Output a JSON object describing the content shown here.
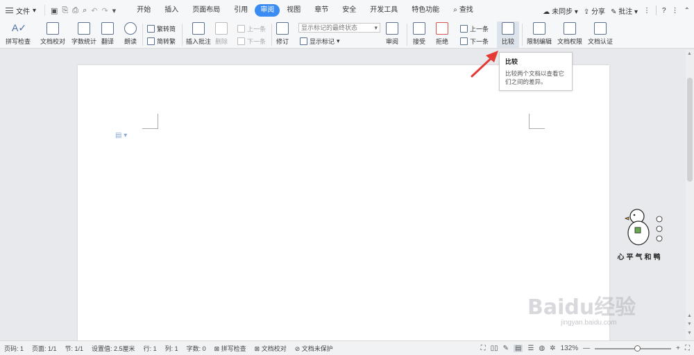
{
  "app": {
    "file_menu": "文件",
    "tabs": [
      "开始",
      "插入",
      "页面布局",
      "引用",
      "审阅",
      "视图",
      "章节",
      "安全",
      "开发工具",
      "特色功能"
    ],
    "active_tab": "审阅",
    "search_label": "查找",
    "sync_label": "未同步",
    "share_label": "分享",
    "comment_label": "批注",
    "help_label": "?"
  },
  "ribbon": {
    "spell_check": "拼写检查",
    "doc_proofread": "文档校对",
    "word_count": "字数统计",
    "translate": "翻译",
    "read_aloud": "朗读",
    "trad_to_simp": "繁转简",
    "simp_to_trad": "简转繁",
    "insert_comment": "插入批注",
    "delete": "删除",
    "prev_item": "上一条",
    "next_item": "下一条",
    "revise": "修订",
    "markup_state": "显示标记的最终状态",
    "show_markup": "显示标记",
    "review_pane": "审阅",
    "accept": "接受",
    "reject": "拒绝",
    "prev_change": "上一条",
    "next_change": "下一条",
    "compare": "比较",
    "restrict_edit": "限制编辑",
    "doc_permission": "文档权限",
    "doc_cert": "文档认证"
  },
  "tooltip": {
    "title": "比较",
    "body": "比较两个文档以查看它们之间的差异。"
  },
  "watermark": {
    "text": "心平气和鸭",
    "baidu": "Baidu经验",
    "url": "jingyan.baidu.com"
  },
  "statusbar": {
    "page_code": "页码: 1",
    "page": "页面: 1/1",
    "section": "节: 1/1",
    "setting": "设置值: 2.5厘米",
    "row": "行: 1",
    "col": "列: 1",
    "chars": "字数: 0",
    "spell": "拼写检查",
    "proof": "文档校对",
    "protect": "文档未保护",
    "zoom": "132%",
    "zoom_level": 0.56
  },
  "colors": {
    "accent": "#3b8cf2",
    "arrow": "#e53935"
  }
}
